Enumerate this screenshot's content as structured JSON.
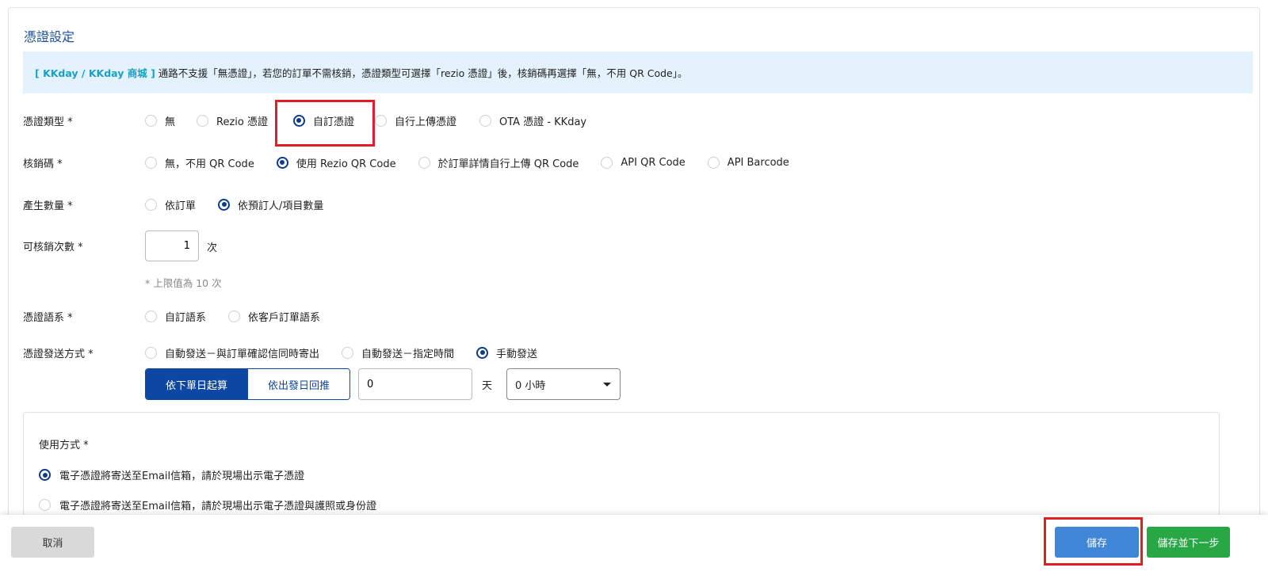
{
  "section": {
    "title": "憑證設定"
  },
  "notice": {
    "tag": "[ KKday / KKday 商城 ]",
    "text": "通路不支援「無憑證」，若您的訂單不需核銷，憑證類型可選擇「rezio 憑證」後，核銷碼再選擇「無，不用 QR Code」。"
  },
  "voucher_type": {
    "label": "憑證類型 *",
    "options": [
      {
        "label": "無",
        "checked": false
      },
      {
        "label": "Rezio 憑證",
        "checked": false
      },
      {
        "label": "自訂憑證",
        "checked": true
      },
      {
        "label": "自行上傳憑證",
        "checked": false
      },
      {
        "label": "OTA 憑證 - KKday",
        "checked": false
      }
    ]
  },
  "redeem_code": {
    "label": "核銷碼 *",
    "options": [
      {
        "label": "無，不用 QR Code",
        "checked": false
      },
      {
        "label": "使用 Rezio QR Code",
        "checked": true
      },
      {
        "label": "於訂單詳情自行上傳 QR Code",
        "checked": false
      },
      {
        "label": "API QR Code",
        "checked": false
      },
      {
        "label": "API Barcode",
        "checked": false
      }
    ]
  },
  "quantity": {
    "label": "產生數量 *",
    "options": [
      {
        "label": "依訂單",
        "checked": false
      },
      {
        "label": "依預訂人/項目數量",
        "checked": true
      }
    ]
  },
  "redeem_times": {
    "label": "可核銷次數 *",
    "value": "1",
    "unit": "次",
    "hint": "* 上限值為 10 次"
  },
  "language": {
    "label": "憑證語系 *",
    "options": [
      {
        "label": "自訂語系",
        "checked": false
      },
      {
        "label": "依客戶訂單語系",
        "checked": false
      }
    ]
  },
  "send_method": {
    "label": "憑證發送方式 *",
    "options": [
      {
        "label": "自動發送－與訂單確認信同時寄出",
        "checked": false
      },
      {
        "label": "自動發送－指定時間",
        "checked": false
      },
      {
        "label": "手動發送",
        "checked": true
      }
    ],
    "segment": {
      "active": "依下單日起算",
      "inactive": "依出發日回推"
    },
    "days_value": "0",
    "days_unit": "天",
    "hours_selected": "0 小時"
  },
  "usage": {
    "title": "使用方式 *",
    "options": [
      {
        "label": "電子憑證將寄送至Email信箱，請於現場出示電子憑證",
        "checked": true
      },
      {
        "label": "電子憑證將寄送至Email信箱，請於現場出示電子憑證與護照或身份證",
        "checked": false
      }
    ]
  },
  "footer": {
    "cancel_label": "取消",
    "save_label": "儲存",
    "save_next_label": "儲存並下一步"
  },
  "colors": {
    "primary": "#0d3b8c",
    "notice_bg": "#e3f2fd",
    "notice_tag": "#17a2c5",
    "save": "#3f86d6",
    "save_next": "#28a745",
    "highlight": "#e31e24"
  }
}
